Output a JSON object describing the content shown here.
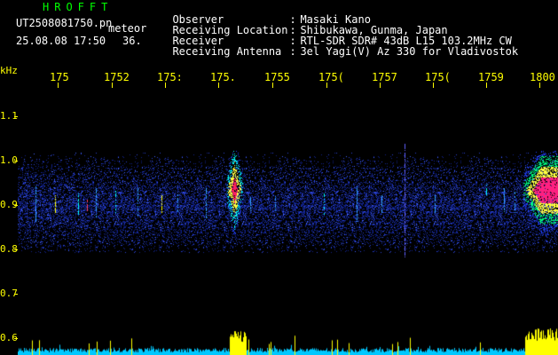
{
  "header": {
    "brand": "HROFFT",
    "filename": "UT2508081750.pn",
    "mode_label": "meteor",
    "datetime": "25.08.08 17:50",
    "count": "36."
  },
  "info": [
    {
      "label": "Observer",
      "value": "Masaki Kano"
    },
    {
      "label": "Receiving Location",
      "value": "Shibukawa, Gunma, Japan"
    },
    {
      "label": "Receiver",
      "value": "RTL-SDR SDR# 43dB L15 103.2MHz CW"
    },
    {
      "label": "Receiving Antenna",
      "value": "3el Yagi(V) Az 330 for Vladivostok"
    }
  ],
  "axis": {
    "y_unit": "kHz",
    "x_ticks": [
      "175",
      "1752",
      "175:",
      "175.",
      "1755",
      "175(",
      "1757",
      "175(",
      "1759",
      "1800"
    ],
    "y_ticks": [
      "1.1",
      "1.0",
      "0.9",
      "0.8",
      "0.7",
      "0.6"
    ]
  },
  "colors": {
    "background": "#000000",
    "axis": "#ffff00",
    "text": "#ffffff",
    "brand": "#00ff00",
    "wave_fill": "#ffff00",
    "wave_low": "#00c8ff",
    "signal_band": "#1a2a9a"
  }
}
